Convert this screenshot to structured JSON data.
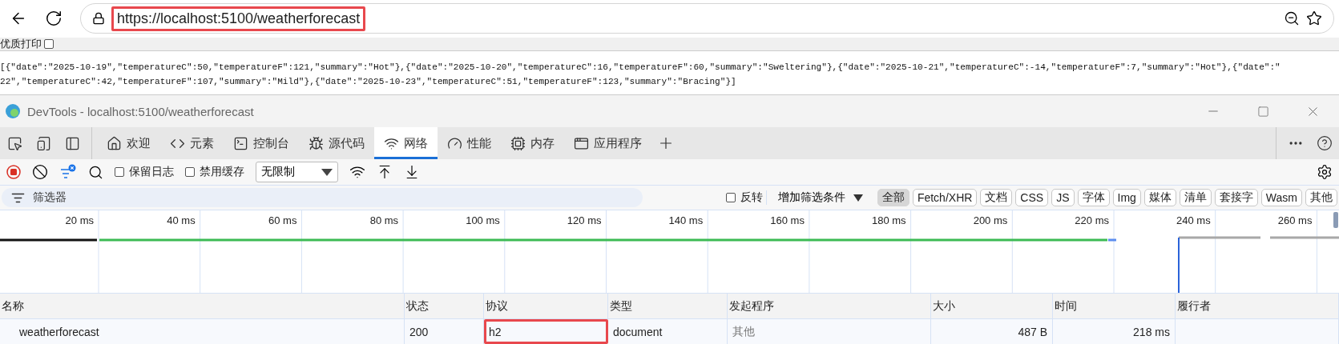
{
  "browser": {
    "url": "https://localhost:5100/weatherforecast",
    "url_highlighted": true
  },
  "print_option": {
    "label": "优质打印",
    "checked": false
  },
  "page_text": [
    "[{\"date\":\"2025-10-19\",\"temperatureC\":50,\"temperatureF\":121,\"summary\":\"Hot\"},{\"date\":\"2025-10-20\",\"temperatureC\":16,\"temperatureF\":60,\"summary\":\"Sweltering\"},{\"date\":\"2025-10-21\",\"temperatureC\":-14,\"temperatureF\":7,\"summary\":\"Hot\"},{\"date\":\"",
    "22\",\"temperatureC\":42,\"temperatureF\":107,\"summary\":\"Mild\"},{\"date\":\"2025-10-23\",\"temperatureC\":51,\"temperatureF\":123,\"summary\":\"Bracing\"}]"
  ],
  "devtools": {
    "title": "DevTools - localhost:5100/weatherforecast",
    "tabs": [
      {
        "label": "欢迎",
        "kind": "home",
        "selected": false
      },
      {
        "label": "元素",
        "kind": "code",
        "selected": false
      },
      {
        "label": "控制台",
        "kind": "console",
        "selected": false
      },
      {
        "label": "源代码",
        "kind": "bug",
        "selected": false
      },
      {
        "label": "网络",
        "kind": "wifi",
        "selected": true
      },
      {
        "label": "性能",
        "kind": "gauge",
        "selected": false
      },
      {
        "label": "内存",
        "kind": "chip",
        "selected": false
      },
      {
        "label": "应用程序",
        "kind": "window",
        "selected": false
      }
    ],
    "toolbar": {
      "recording": true,
      "preserve_log": {
        "label": "保留日志",
        "checked": false
      },
      "disable_cache": {
        "label": "禁用缓存",
        "checked": false
      },
      "throttling": "无限制"
    },
    "filter": {
      "placeholder": "筛选器",
      "invert": {
        "label": "反转",
        "checked": false
      },
      "more_filters": "增加筛选条件",
      "types": [
        {
          "label": "全部",
          "selected": true
        },
        {
          "label": "Fetch/XHR",
          "selected": false
        },
        {
          "label": "文档",
          "selected": false
        },
        {
          "label": "CSS",
          "selected": false
        },
        {
          "label": "JS",
          "selected": false
        },
        {
          "label": "字体",
          "selected": false
        },
        {
          "label": "Img",
          "selected": false
        },
        {
          "label": "媒体",
          "selected": false
        },
        {
          "label": "清单",
          "selected": false
        },
        {
          "label": "套接字",
          "selected": false
        },
        {
          "label": "Wasm",
          "selected": false
        },
        {
          "label": "其他",
          "selected": false
        }
      ]
    },
    "timeline": {
      "ticks": [
        "20 ms",
        "40 ms",
        "60 ms",
        "80 ms",
        "100 ms",
        "120 ms",
        "140 ms",
        "160 ms",
        "180 ms",
        "200 ms",
        "220 ms",
        "240 ms",
        "260 ms"
      ]
    },
    "table": {
      "columns": [
        "名称",
        "状态",
        "协议",
        "类型",
        "发起程序",
        "大小",
        "时间",
        "履行者"
      ],
      "rows": [
        {
          "name": "weatherforecast",
          "status": "200",
          "protocol": "h2",
          "protocol_highlighted": true,
          "type": "document",
          "initiator": "其他",
          "size": "487 B",
          "time": "218 ms"
        }
      ]
    }
  }
}
